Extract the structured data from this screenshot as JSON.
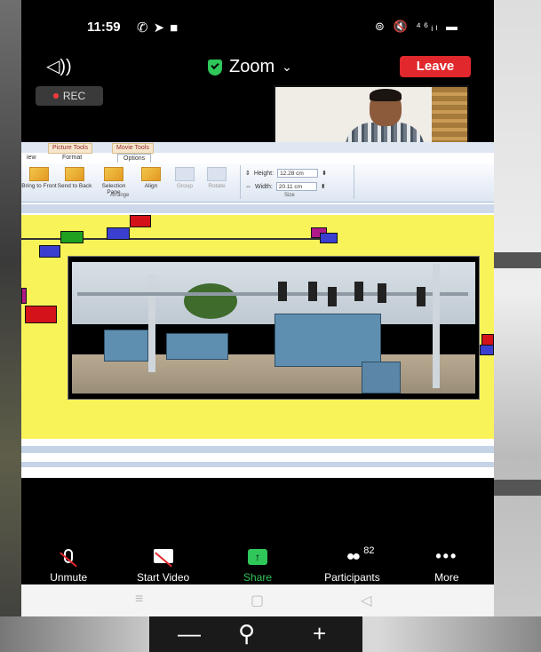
{
  "status": {
    "time": "11:59",
    "left_icons": [
      "whatsapp-icon",
      "telegram-icon",
      "video-call-icon"
    ],
    "right_icons_text": "⊚ 🔇 ⁴⁶ᵢₗ ▬"
  },
  "header": {
    "speaker_icon": "◁))",
    "title": "Zoom",
    "chevron": "⌄",
    "leave_label": "Leave",
    "rec_label": "REC"
  },
  "shared_screen": {
    "context_tabs": [
      "Picture Tools",
      "Movie Tools"
    ],
    "tabs": [
      "Format",
      "Options"
    ],
    "tab_fragment": "iew",
    "ribbon_buttons": [
      {
        "label": "Bring to Front",
        "dim": false
      },
      {
        "label": "Send to Back",
        "dim": false
      },
      {
        "label": "Selection Pane",
        "dim": false
      },
      {
        "label": "Align",
        "dim": false
      },
      {
        "label": "Group",
        "dim": true
      },
      {
        "label": "Rotate",
        "dim": true
      }
    ],
    "group_arrange": "Arrange",
    "group_size": "Size",
    "height_label": "Height:",
    "height_value": "12.28 cm",
    "width_label": "Width:",
    "width_value": "20.11 cm"
  },
  "toolbar": {
    "unmute": "Unmute",
    "start_video": "Start Video",
    "share": "Share",
    "share_glyph": "↑",
    "participants": "Participants",
    "participants_count": "82",
    "more": "More",
    "more_glyph": "•••"
  },
  "navbar": {
    "recent": "≡",
    "home": "▢",
    "back": "◁"
  },
  "zoom_controls": {
    "minus": "—",
    "magnifier": "⚲",
    "plus": "+"
  },
  "colors": {
    "leave_red": "#e0282d",
    "share_green": "#2fc65a",
    "slide_yellow": "#f9f35a"
  }
}
